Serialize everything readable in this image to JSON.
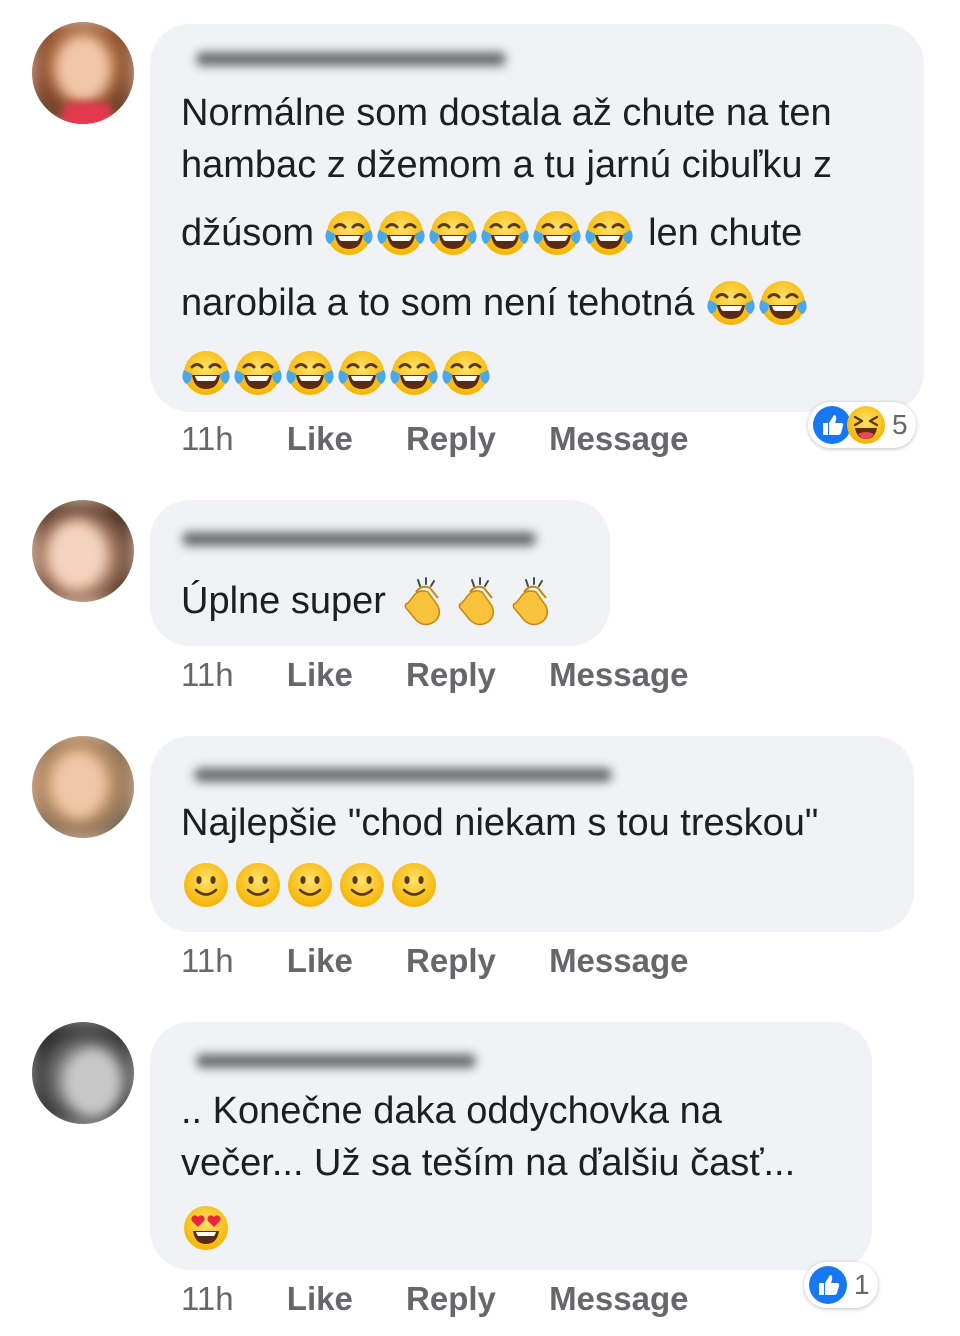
{
  "comments": [
    {
      "text_lines": [
        "Normálne som dostala až chute na ten",
        "hambac z džemom a tu jarnú cibuľku z",
        "džúsom",
        "len chute",
        "narobila a to som není tehotná"
      ],
      "time": "11h",
      "like_label": "Like",
      "reply_label": "Reply",
      "message_label": "Message",
      "reaction_count": "5",
      "reactions": [
        "like-icon",
        "haha-icon"
      ],
      "emojis": [
        "tears-of-joy-emoji"
      ]
    },
    {
      "text_lines": [
        "Úplne super"
      ],
      "time": "11h",
      "like_label": "Like",
      "reply_label": "Reply",
      "message_label": "Message",
      "emojis": [
        "clapping-hands-emoji"
      ]
    },
    {
      "text_lines": [
        "Najlepšie \"chod niekam s tou treskou\""
      ],
      "time": "11h",
      "like_label": "Like",
      "reply_label": "Reply",
      "message_label": "Message",
      "emojis": [
        "slightly-smiling-emoji"
      ]
    },
    {
      "text_lines": [
        ".. Konečne daka oddychovka na",
        "večer... Už sa teším na ďalšiu časť..."
      ],
      "time": "11h",
      "like_label": "Like",
      "reply_label": "Reply",
      "message_label": "Message",
      "reaction_count": "1",
      "reactions": [
        "like-icon"
      ],
      "emojis": [
        "heart-eyes-emoji"
      ]
    }
  ],
  "colors": {
    "bubble": "#f0f2f5",
    "action_text": "#65676b",
    "like_blue": "#1877f2",
    "emoji_yellow": "#fcc21b"
  }
}
